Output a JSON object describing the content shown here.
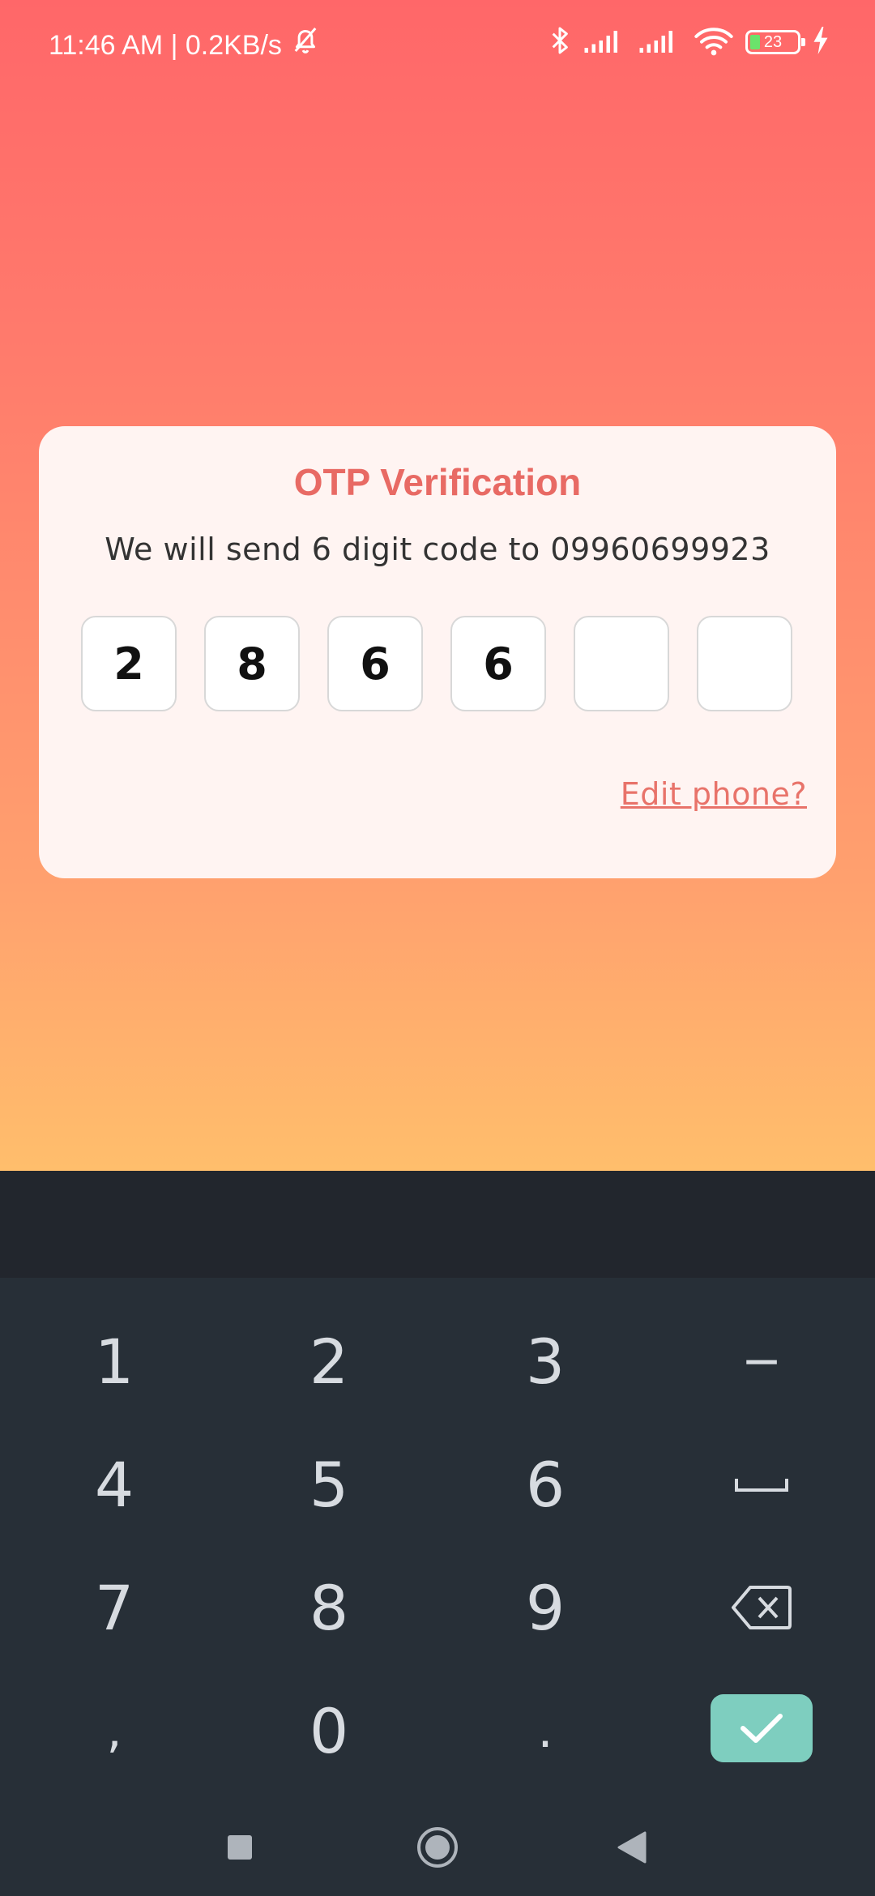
{
  "status_bar": {
    "time_network": "11:46 AM | 0.2KB/s",
    "battery_level": "23",
    "icons": [
      "mute-icon",
      "bluetooth-icon",
      "signal-icon",
      "signal-icon",
      "wifi-icon",
      "battery-icon",
      "charging-icon"
    ]
  },
  "otp_card": {
    "title": "OTP Verification",
    "subtitle": "We will send 6 digit code to 09960699923",
    "digits": [
      "2",
      "8",
      "6",
      "6",
      "",
      ""
    ],
    "edit_phone": "Edit phone?"
  },
  "keyboard": {
    "rows": [
      [
        "1",
        "2",
        "3",
        "−"
      ],
      [
        "4",
        "5",
        "6",
        "space"
      ],
      [
        "7",
        "8",
        "9",
        "backspace"
      ],
      [
        ",",
        "0",
        ".",
        "done"
      ]
    ],
    "key_1": "1",
    "key_2": "2",
    "key_3": "3",
    "key_minus": "−",
    "key_4": "4",
    "key_5": "5",
    "key_6": "6",
    "key_7": "7",
    "key_8": "8",
    "key_9": "9",
    "key_comma": ",",
    "key_0": "0",
    "key_period": "."
  },
  "colors": {
    "accent": "#e86a64",
    "done_key": "#7ecebf",
    "keyboard_bg": "#272f37",
    "gradient_top": "#ff6769",
    "gradient_bottom": "#ffbe6c"
  }
}
